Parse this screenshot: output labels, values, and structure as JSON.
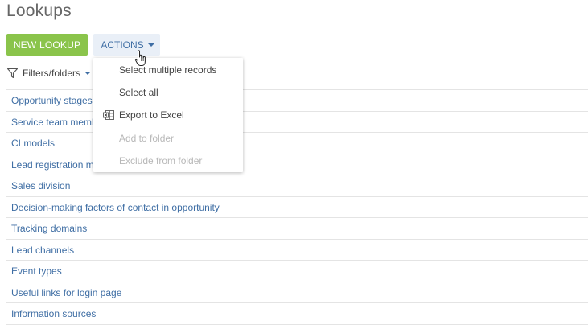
{
  "page": {
    "title": "Lookups"
  },
  "toolbar": {
    "new_label": "NEW LOOKUP",
    "actions_label": "ACTIONS"
  },
  "filters": {
    "label": "Filters/folders"
  },
  "actions_menu": {
    "items": [
      {
        "label": "Select multiple records",
        "enabled": true
      },
      {
        "label": "Select all",
        "enabled": true
      },
      {
        "label": "Export to Excel",
        "enabled": true,
        "icon": "excel-export-icon"
      },
      {
        "label": "Add to folder",
        "enabled": false
      },
      {
        "label": "Exclude from folder",
        "enabled": false
      }
    ]
  },
  "lookups": {
    "items": [
      "Opportunity stages",
      "Service team members",
      "CI models",
      "Lead registration methods",
      "Sales division",
      "Decision-making factors of contact in opportunity",
      "Tracking domains",
      "Lead channels",
      "Event types",
      "Useful links for login page",
      "Information sources"
    ]
  },
  "colors": {
    "primary_button": "#8ac44b",
    "link": "#3f6ea4",
    "actions_button_bg": "#e9eff7"
  }
}
